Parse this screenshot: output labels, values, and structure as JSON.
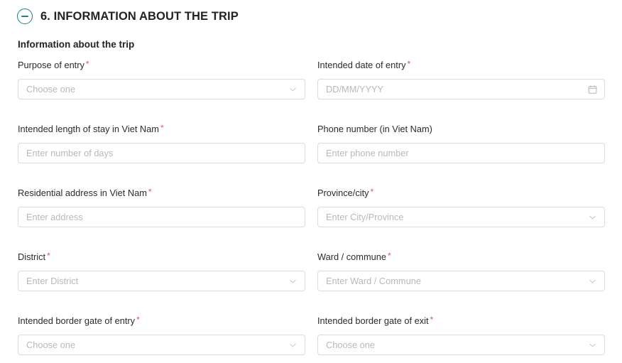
{
  "section": {
    "number_title": "6. INFORMATION ABOUT THE TRIP",
    "collapse_icon": "minus-circle-icon",
    "accent_color": "#1b7f88"
  },
  "sub_heading": "Information about the trip",
  "colors": {
    "required_asterisk": "#e8505b",
    "border": "#dcdcdc",
    "placeholder": "#b9b9b9",
    "text": "#262626"
  },
  "required_marker": "*",
  "form": {
    "rows": [
      {
        "left": {
          "label": "Purpose of entry",
          "required": true,
          "placeholder": "Choose one",
          "type": "select",
          "icon": "chevron-down-icon",
          "name": "purpose-of-entry"
        },
        "right": {
          "label": "Intended date of entry",
          "required": true,
          "placeholder": "DD/MM/YYYY",
          "type": "date",
          "icon": "calendar-icon",
          "name": "intended-date-of-entry"
        }
      },
      {
        "left": {
          "label": "Intended length of stay in Viet Nam",
          "required": true,
          "placeholder": "Enter number of days",
          "type": "text",
          "icon": "",
          "name": "intended-length-of-stay"
        },
        "right": {
          "label": "Phone number (in Viet Nam)",
          "required": false,
          "placeholder": "Enter phone number",
          "type": "text",
          "icon": "",
          "name": "phone-number"
        }
      },
      {
        "left": {
          "label": "Residential address in Viet Nam",
          "required": true,
          "placeholder": "Enter address",
          "type": "text",
          "icon": "",
          "name": "residential-address"
        },
        "right": {
          "label": "Province/city",
          "required": true,
          "placeholder": "Enter City/Province",
          "type": "select",
          "icon": "chevron-down-icon",
          "name": "province-city"
        }
      },
      {
        "left": {
          "label": "District",
          "required": true,
          "placeholder": "Enter District",
          "type": "select",
          "icon": "chevron-down-icon",
          "name": "district"
        },
        "right": {
          "label": "Ward / commune",
          "required": true,
          "placeholder": "Enter Ward / Commune",
          "type": "select",
          "icon": "chevron-down-icon",
          "name": "ward-commune"
        }
      },
      {
        "left": {
          "label": "Intended border gate of entry",
          "required": true,
          "placeholder": "Choose one",
          "type": "select",
          "icon": "chevron-down-icon",
          "name": "border-gate-entry"
        },
        "right": {
          "label": "Intended border gate of exit",
          "required": true,
          "placeholder": "Choose one",
          "type": "select",
          "icon": "chevron-down-icon",
          "name": "border-gate-exit"
        }
      }
    ]
  }
}
